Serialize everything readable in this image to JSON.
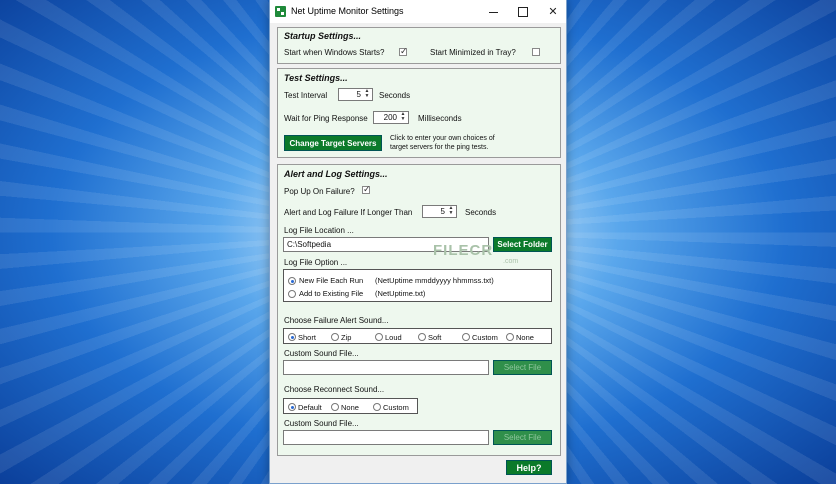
{
  "window": {
    "title": "Net Uptime Monitor Settings",
    "minimize": "–",
    "maximize": "□",
    "close": "✕"
  },
  "startup": {
    "title": "Startup Settings...",
    "start_with_windows": {
      "label": "Start when Windows Starts?",
      "checked": true
    },
    "start_minimized": {
      "label": "Start Minimized in Tray?",
      "checked": false
    }
  },
  "test": {
    "title": "Test Settings...",
    "interval_label": "Test Interval",
    "interval_value": "5",
    "interval_unit": "Seconds",
    "ping_label": "Wait for Ping Response",
    "ping_value": "200",
    "ping_unit": "Milliseconds",
    "change_servers_label": "Change Target Servers",
    "change_servers_desc_1": "Click to enter your own choices of",
    "change_servers_desc_2": "target servers for the ping tests."
  },
  "alert": {
    "title": "Alert and Log Settings...",
    "popup_label": "Pop Up On Failure?",
    "popup_checked": true,
    "longer_label": "Alert and Log Failure If Longer Than",
    "longer_value": "5",
    "longer_unit": "Seconds",
    "log_location_label": "Log File Location ...",
    "log_location_value": "C:\\Softpedia",
    "select_folder_label": "Select Folder",
    "log_option_label": "Log File Option ...",
    "log_options": [
      {
        "label": "New File Each Run",
        "format": "(NetUptime mmddyyyy hhmmss.txt)",
        "selected": true
      },
      {
        "label": "Add to Existing File",
        "format": "(NetUptime.txt)",
        "selected": false
      }
    ],
    "failure_sound_label": "Choose Failure Alert Sound...",
    "failure_sounds": [
      "Short",
      "Zip",
      "Loud",
      "Soft",
      "Custom",
      "None"
    ],
    "failure_sound_selected": "Short",
    "custom_sound_label": "Custom Sound File...",
    "select_file_label": "Select File",
    "reconnect_sound_label": "Choose Reconnect Sound...",
    "reconnect_sounds": [
      "Default",
      "None",
      "Custom"
    ],
    "reconnect_sound_selected": "Default",
    "custom_sound_label_2": "Custom Sound File...",
    "select_file_label_2": "Select File"
  },
  "watermark": {
    "main": "FILECR",
    "sub": ".com"
  },
  "help_label": "Help?"
}
